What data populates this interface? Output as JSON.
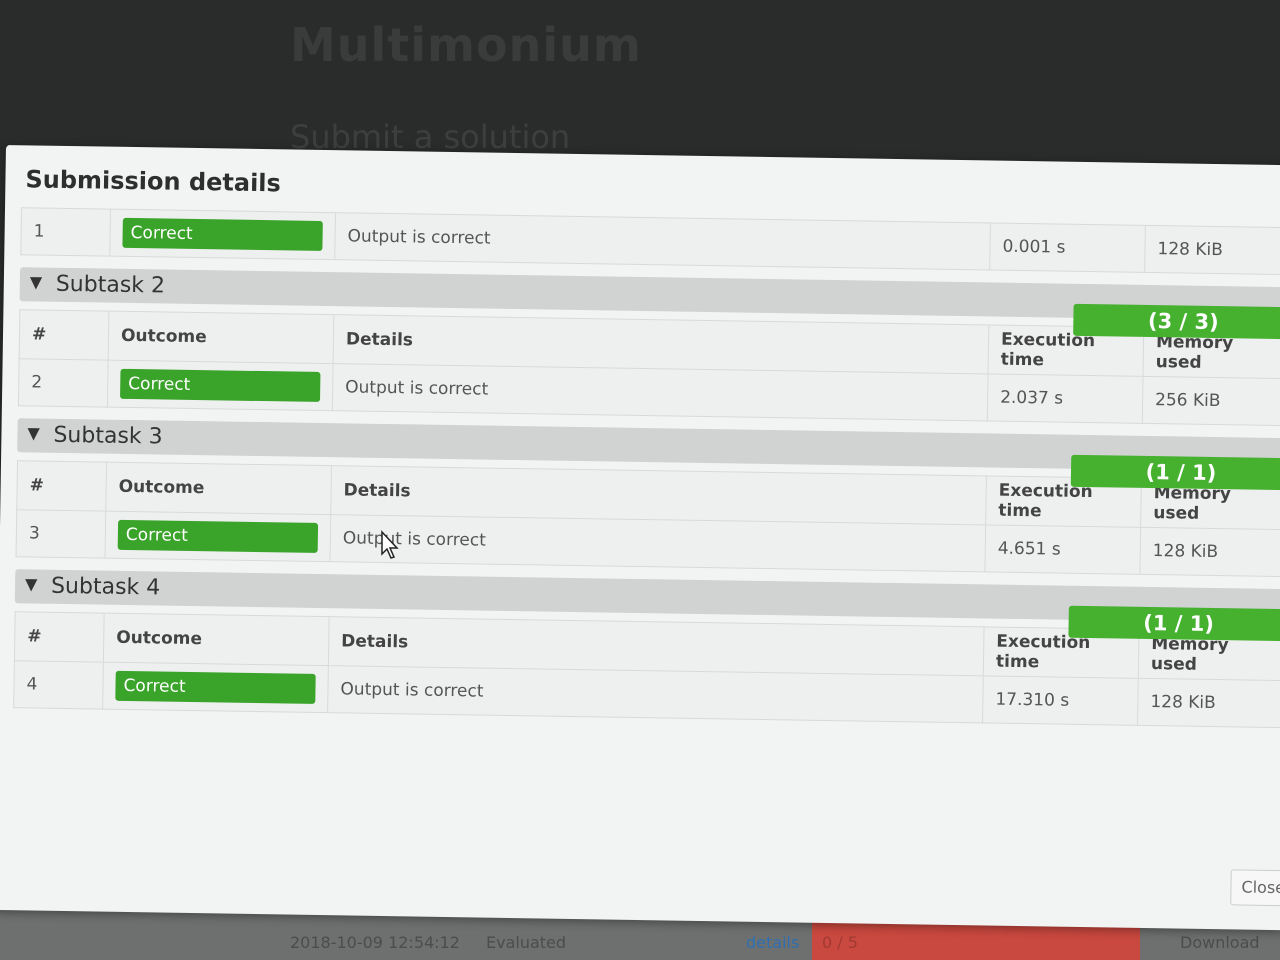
{
  "background": {
    "title": "Multimonium",
    "section": "Submit a solution",
    "submission_row": {
      "timestamp": "2018-10-09 12:54:12",
      "status": "Evaluated",
      "details_link": "details",
      "score": "0 / 5",
      "download": "Download"
    }
  },
  "modal": {
    "title": "Submission details",
    "close_label": "Close",
    "columns": {
      "num": "#",
      "outcome": "Outcome",
      "details": "Details",
      "time": "Execution time",
      "memory": "Memory used"
    },
    "first_row": {
      "num": "1",
      "outcome": "Correct",
      "details": "Output is correct",
      "time": "0.001 s",
      "memory": "128 KiB"
    },
    "subtasks": [
      {
        "name": "Subtask 2",
        "score": "(3 / 3)",
        "row": {
          "num": "2",
          "outcome": "Correct",
          "details": "Output is correct",
          "time": "2.037 s",
          "memory": "256 KiB"
        }
      },
      {
        "name": "Subtask 3",
        "score": "(1 / 1)",
        "row": {
          "num": "3",
          "outcome": "Correct",
          "details": "Output is correct",
          "time": "4.651 s",
          "memory": "128 KiB"
        }
      },
      {
        "name": "Subtask 4",
        "score": "(1 / 1)",
        "row": {
          "num": "4",
          "outcome": "Correct",
          "details": "Output is correct",
          "time": "17.310 s",
          "memory": "128 KiB"
        }
      }
    ]
  },
  "colors": {
    "correct": "#3aa32a",
    "score_bar": "#46b02f",
    "failed": "#c9483f"
  },
  "icons": {
    "subtask_toggle": "chevron-down-icon",
    "pointer": "mouse-cursor-icon"
  }
}
